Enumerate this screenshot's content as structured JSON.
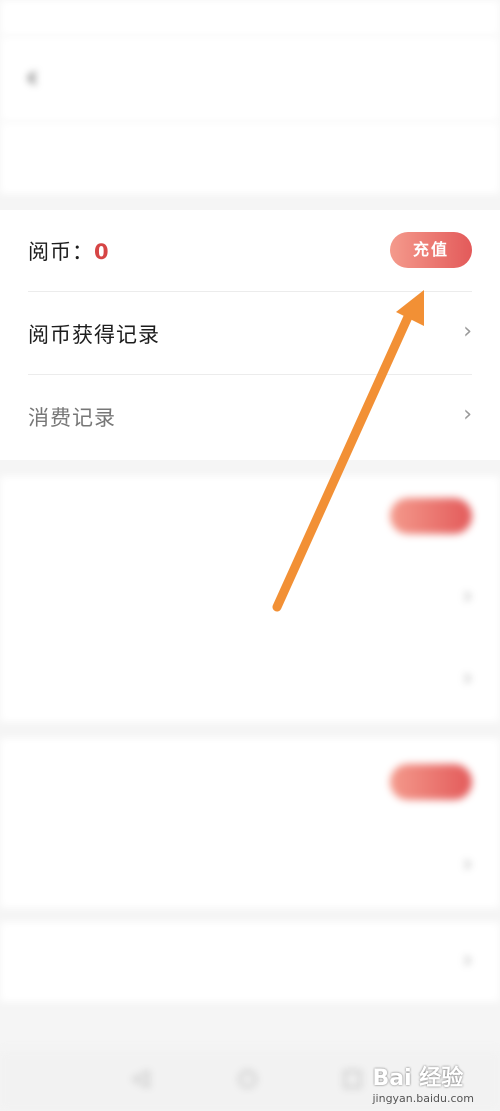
{
  "status_bar": {
    "left": "",
    "right": ""
  },
  "header": {
    "back_icon": "chevron-left-icon",
    "title": ""
  },
  "account": {
    "label": "",
    "value": ""
  },
  "coins_card": {
    "balance_label": "阅币：",
    "balance_value": "0",
    "recharge_button": "充值",
    "earn_records": "阅币获得记录",
    "consume_records": "消费记录",
    "chevron_icon": "chevron-right-icon"
  },
  "blurred_sections": {
    "gold_label": "",
    "gold_value": "",
    "gold_button": "",
    "gold_row1": "",
    "gold_row2": "",
    "vip_label": "",
    "vip_sub": "",
    "vip_button": "",
    "vip_row1": "",
    "bottom_row": ""
  },
  "bottom_nav": {
    "icons": [
      "back-triangle-icon",
      "home-circle-icon",
      "recents-square-icon"
    ]
  },
  "watermark": {
    "text": "Bai 经验",
    "url": "jingyan.baidu.com"
  },
  "annotation": {
    "arrow_color": "#f29035"
  },
  "colors": {
    "accent": "#e35a5a",
    "value_red": "#d64545"
  }
}
